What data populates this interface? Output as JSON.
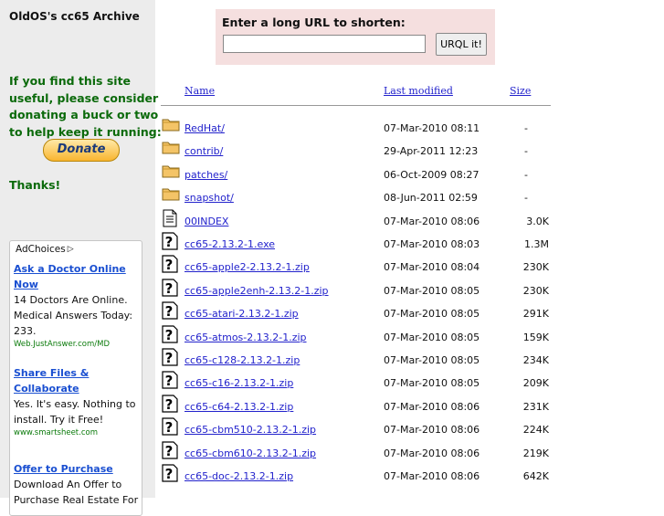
{
  "site": {
    "title": "OldOS's cc65 Archive"
  },
  "sidebar": {
    "donate_text": "If you find this site useful, please consider donating a buck or two to help keep it running:",
    "donate_button": "Donate",
    "thanks": "Thanks!"
  },
  "ads": {
    "choices_label": "AdChoices",
    "items": [
      {
        "title_line1": "Ask a Doctor Online",
        "title_line2": "Now",
        "body": "14 Doctors Are Online. Medical Answers Today: 233.",
        "url": "Web.JustAnswer.com/MD"
      },
      {
        "title_line1": "Share Files &",
        "title_line2": "Collaborate",
        "body": "Yes. It's easy. Nothing to install. Try it Free!",
        "url": "www.smartsheet.com"
      },
      {
        "title_line1": "Offer to Purchase",
        "title_line2": "",
        "body": "Download An Offer to Purchase Real Estate For",
        "url": ""
      }
    ]
  },
  "shortener": {
    "label": "Enter a long URL to shorten:",
    "input_value": "",
    "button_label": "URQL it!"
  },
  "listing": {
    "columns": {
      "name": "Name",
      "modified": "Last modified",
      "size": "Size"
    },
    "rows": [
      {
        "icon": "folder-icon",
        "name": "RedHat/",
        "modified": "07-Mar-2010 08:11",
        "size": "-"
      },
      {
        "icon": "folder-icon",
        "name": "contrib/",
        "modified": "29-Apr-2011 12:23",
        "size": "-"
      },
      {
        "icon": "folder-icon",
        "name": "patches/",
        "modified": "06-Oct-2009 08:27",
        "size": "-"
      },
      {
        "icon": "folder-icon",
        "name": "snapshot/",
        "modified": "08-Jun-2011 02:59",
        "size": "-"
      },
      {
        "icon": "text-file-icon",
        "name": "00INDEX",
        "modified": "07-Mar-2010 08:06",
        "size": "3.0K"
      },
      {
        "icon": "unknown-file-icon",
        "name": "cc65-2.13.2-1.exe",
        "modified": "07-Mar-2010 08:03",
        "size": "1.3M"
      },
      {
        "icon": "unknown-file-icon",
        "name": "cc65-apple2-2.13.2-1.zip",
        "modified": "07-Mar-2010 08:04",
        "size": "230K"
      },
      {
        "icon": "unknown-file-icon",
        "name": "cc65-apple2enh-2.13.2-1.zip",
        "modified": "07-Mar-2010 08:05",
        "size": "230K"
      },
      {
        "icon": "unknown-file-icon",
        "name": "cc65-atari-2.13.2-1.zip",
        "modified": "07-Mar-2010 08:05",
        "size": "291K"
      },
      {
        "icon": "unknown-file-icon",
        "name": "cc65-atmos-2.13.2-1.zip",
        "modified": "07-Mar-2010 08:05",
        "size": "159K"
      },
      {
        "icon": "unknown-file-icon",
        "name": "cc65-c128-2.13.2-1.zip",
        "modified": "07-Mar-2010 08:05",
        "size": "234K"
      },
      {
        "icon": "unknown-file-icon",
        "name": "cc65-c16-2.13.2-1.zip",
        "modified": "07-Mar-2010 08:05",
        "size": "209K"
      },
      {
        "icon": "unknown-file-icon",
        "name": "cc65-c64-2.13.2-1.zip",
        "modified": "07-Mar-2010 08:06",
        "size": "231K"
      },
      {
        "icon": "unknown-file-icon",
        "name": "cc65-cbm510-2.13.2-1.zip",
        "modified": "07-Mar-2010 08:06",
        "size": "224K"
      },
      {
        "icon": "unknown-file-icon",
        "name": "cc65-cbm610-2.13.2-1.zip",
        "modified": "07-Mar-2010 08:06",
        "size": "219K"
      },
      {
        "icon": "unknown-file-icon",
        "name": "cc65-doc-2.13.2-1.zip",
        "modified": "07-Mar-2010 08:06",
        "size": "642K"
      }
    ]
  },
  "colors": {
    "sidebar_bg": "#ececec",
    "donate_green": "#0b6a0b",
    "link_blue": "#2222cc",
    "shortener_bg": "#f5dfdf",
    "ad_link": "#1a4fd1"
  }
}
